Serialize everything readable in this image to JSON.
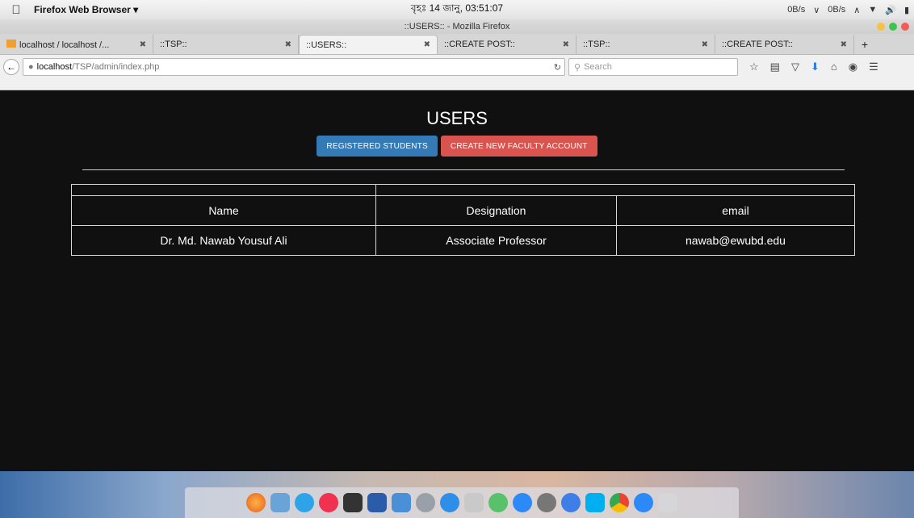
{
  "os_menubar": {
    "app_name": "Firefox Web Browser ▾",
    "clock": "বৃহঃ 14 জানু, 03:51:07",
    "status_icons": [
      "0B/s",
      "∨",
      "0B/s",
      "∧",
      "wifi",
      "volume",
      "battery"
    ]
  },
  "window": {
    "title": "::USERS:: - Mozilla Firefox"
  },
  "tabs": [
    {
      "label": "localhost / localhost /...",
      "active": false
    },
    {
      "label": "::TSP::",
      "active": false
    },
    {
      "label": "::USERS::",
      "active": true
    },
    {
      "label": "::CREATE POST::",
      "active": false
    },
    {
      "label": "::TSP::",
      "active": false
    },
    {
      "label": "::CREATE POST::",
      "active": false
    }
  ],
  "navbar": {
    "url_host": "localhost",
    "url_path": "/TSP/admin/index.php",
    "search_placeholder": "Search"
  },
  "page": {
    "title": "USERS",
    "buttons": {
      "registered_students": "REGISTERED STUDENTS",
      "create_faculty": "CREATE NEW FACULTY ACCOUNT"
    },
    "table": {
      "headers": [
        "Name",
        "Designation",
        "email"
      ],
      "rows": [
        [
          "Dr. Md. Nawab Yousuf Ali",
          "Associate Professor",
          "nawab@ewubd.edu"
        ]
      ]
    }
  },
  "colors": {
    "page_bg": "#101010",
    "primary_button": "#337ab7",
    "danger_button": "#d9534f"
  },
  "dock_icons": [
    "firefox-icon",
    "preview-icon",
    "messages-icon",
    "itunes-icon",
    "photo-booth-icon",
    "word-icon",
    "finder-icon",
    "system-icon",
    "app-store-icon",
    "tools-icon",
    "chat-icon",
    "messenger-icon",
    "settings-icon",
    "bluetooth-icon",
    "skype-icon",
    "chrome-icon",
    "messenger2-icon",
    "launchpad-icon"
  ]
}
